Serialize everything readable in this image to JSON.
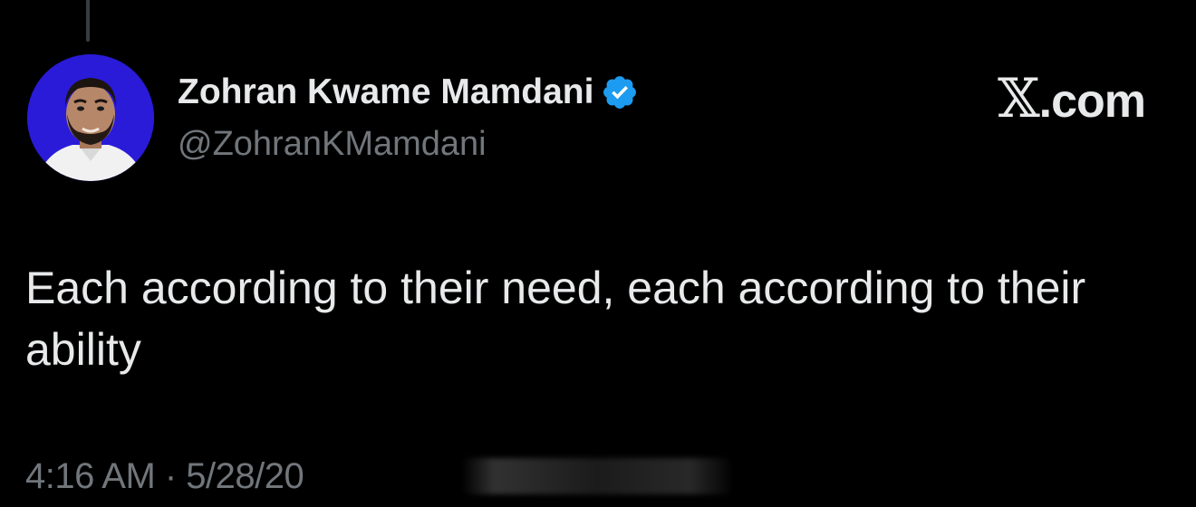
{
  "author": {
    "display_name": "Zohran Kwame Mamdani",
    "handle": "@ZohranKMamdani",
    "verified": true,
    "avatar_background": "#2a1bd8"
  },
  "brand": {
    "label": ".com"
  },
  "tweet": {
    "text": "Each according to their need, each according to their ability",
    "timestamp": "4:16 AM · 5/28/20"
  },
  "colors": {
    "background": "#000000",
    "primary_text": "#e7e9ea",
    "secondary_text": "#71767b",
    "verified_badge": "#1d9bf0"
  },
  "icons": {
    "verified": "verified-badge-icon",
    "brand": "x-logo-icon"
  }
}
